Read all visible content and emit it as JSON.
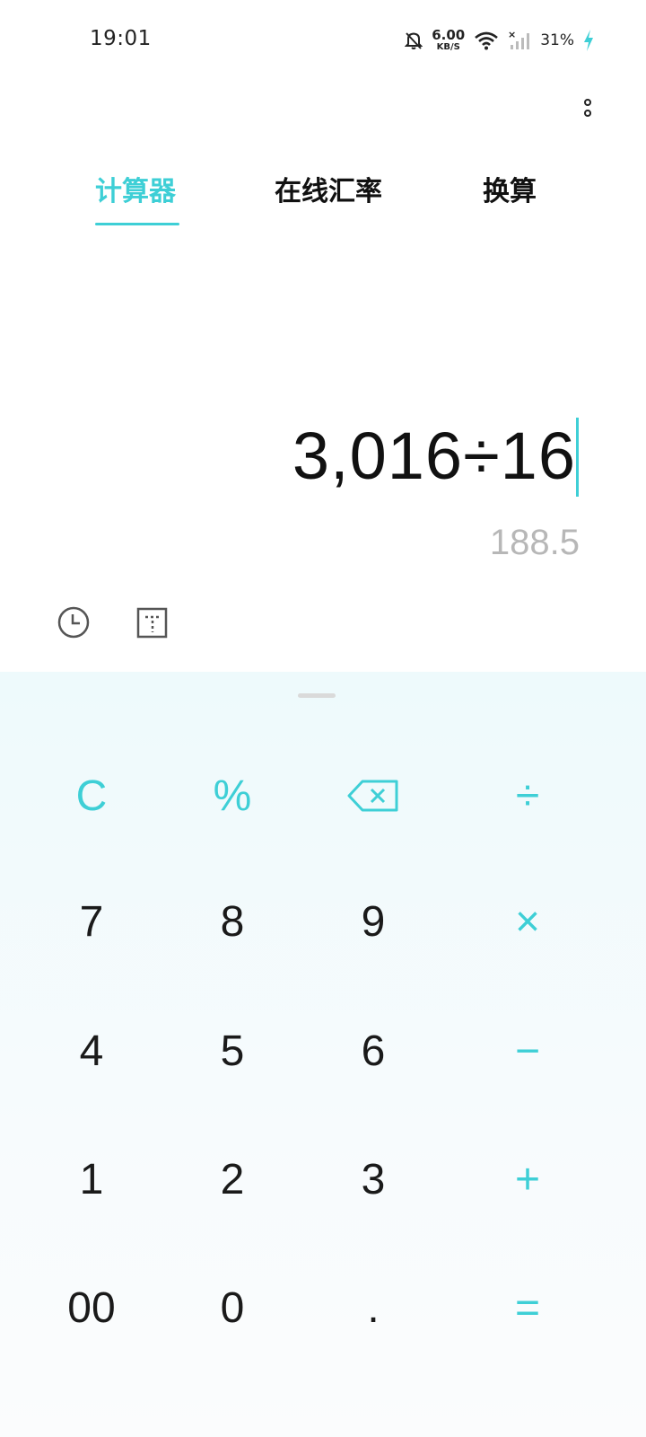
{
  "status_bar": {
    "time": "19:01",
    "net_speed_value": "6.00",
    "net_speed_unit": "KB/S",
    "battery": "31%"
  },
  "tabs": [
    {
      "label": "计算器",
      "active": true
    },
    {
      "label": "在线汇率",
      "active": false
    },
    {
      "label": "换算",
      "active": false
    }
  ],
  "display": {
    "expression": "3,016÷16",
    "result": "188.5"
  },
  "keys": {
    "clear": "C",
    "percent": "%",
    "divide": "÷",
    "seven": "7",
    "eight": "8",
    "nine": "9",
    "multiply": "×",
    "four": "4",
    "five": "5",
    "six": "6",
    "minus": "−",
    "one": "1",
    "two": "2",
    "three": "3",
    "plus": "+",
    "double_zero": "00",
    "zero": "0",
    "decimal": ".",
    "equals": "="
  },
  "colors": {
    "accent": "#3ecfd6",
    "result_text": "#b7b7b7",
    "keypad_bg": "#eefafc"
  }
}
